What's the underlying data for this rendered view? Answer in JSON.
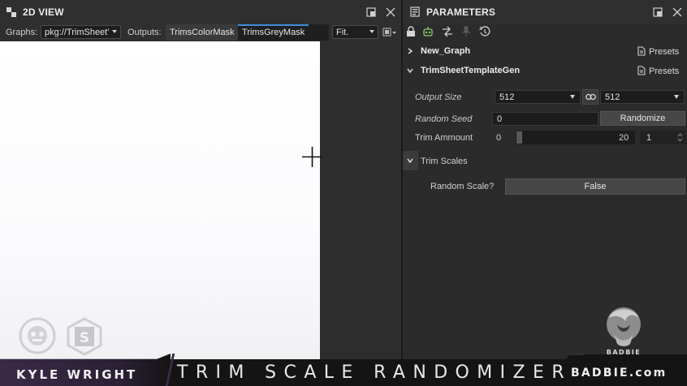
{
  "view_panel": {
    "title": "2D VIEW",
    "graphs_label": "Graphs:",
    "graph_value": "pkg://TrimSheet'",
    "outputs_label": "Outputs:",
    "output_tabs": [
      "TrimsColorMask",
      "TrimsGreyMask"
    ],
    "active_output": "TrimsGreyMask",
    "fit_value": "Fit."
  },
  "params_panel": {
    "title": "PARAMETERS",
    "graph_section": "New_Graph",
    "presets_label": "Presets",
    "template_section": "TrimSheetTemplateGen",
    "output_size": {
      "label": "Output Size",
      "width_value": "512",
      "height_value": "512"
    },
    "random_seed": {
      "label": "Random Seed",
      "value": "0",
      "button": "Randomize"
    },
    "trim_amount": {
      "label": "Trim Ammount",
      "min": "0",
      "max": "20",
      "value": "1"
    },
    "trim_scales": {
      "label": "Trim Scales"
    },
    "random_scale": {
      "label": "Random Scale?",
      "value": "False"
    }
  },
  "branding": {
    "author": "KYLE WRIGHT",
    "video_title": "TRIM SCALE RANDOMIZER",
    "logo_text": "BADBIE",
    "site": "BADBIE.com"
  },
  "colors": {
    "accent": "#3d8fd8",
    "panel_bg": "#2b2b2b",
    "field_bg": "#1c1c1c",
    "brand_purple": "#3a2a48"
  }
}
